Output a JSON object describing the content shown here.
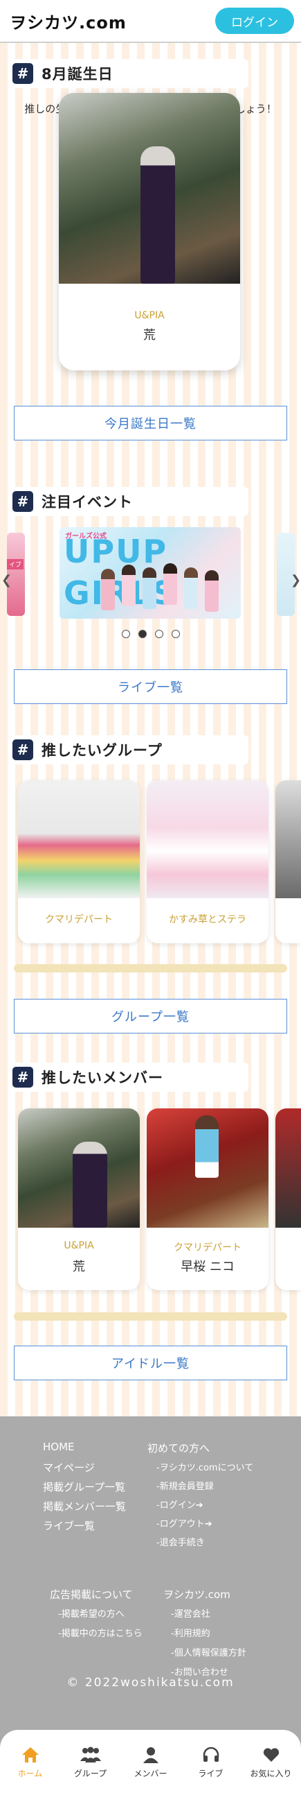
{
  "header": {
    "logo": "ヲシカツ.com",
    "login_label": "ログイン"
  },
  "birthday": {
    "title": "8月誕生日",
    "description": "推しの生誕祭/ライブ情報をチェックしてみましょう！",
    "card": {
      "group": "U&PIA",
      "name": "荒"
    },
    "list_button": "今月誕生日一覧"
  },
  "events": {
    "title": "注目イベント",
    "banner": {
      "tag": "ガールズ公式",
      "line1": "UPUP",
      "line2": "GIRLS"
    },
    "left_peek": "イブ",
    "dots": [
      false,
      true,
      false,
      false
    ],
    "list_button": "ライブ一覧"
  },
  "groups": {
    "title": "推したいグループ",
    "cards": [
      {
        "name": "クマリデパート"
      },
      {
        "name": "かすみ草とステラ"
      }
    ],
    "list_button": "グループ一覧"
  },
  "members": {
    "title": "推したいメンバー",
    "cards": [
      {
        "group": "U&PIA",
        "name": "荒"
      },
      {
        "group": "クマリデパート",
        "name": "早桜 ニコ"
      }
    ],
    "list_button": "アイドル一覧"
  },
  "footer": {
    "col1": [
      "HOME",
      "マイページ",
      "掲載グループ一覧",
      "掲載メンバー一覧",
      "ライブ一覧"
    ],
    "col2_title": "初めての方へ",
    "col2": [
      "-ヲシカツ.comについて",
      "-新規会員登録",
      "-ログイン➔",
      "-ログアウト➔",
      "-退会手続き"
    ],
    "col3_title": "広告掲載について",
    "col3": [
      "-掲載希望の方へ",
      "-掲載中の方はこちら"
    ],
    "col4_title": "ヲシカツ.com",
    "col4": [
      "-運営会社",
      "-利用規約",
      "-個人情報保護方針",
      "-お問い合わせ"
    ],
    "copyright": "© 2022woshikatsu.com"
  },
  "nav": [
    {
      "label": "ホーム",
      "icon": "home-icon",
      "active": true
    },
    {
      "label": "グループ",
      "icon": "group-icon",
      "active": false
    },
    {
      "label": "メンバー",
      "icon": "member-icon",
      "active": false
    },
    {
      "label": "ライブ",
      "icon": "headphones-icon",
      "active": false
    },
    {
      "label": "お気に入り",
      "icon": "heart-icon",
      "active": false
    }
  ],
  "colors": {
    "accent": "#2cc0e0",
    "nav_active": "#f0a020",
    "group_label": "#c9a135",
    "button_border": "#5b8fd6"
  }
}
